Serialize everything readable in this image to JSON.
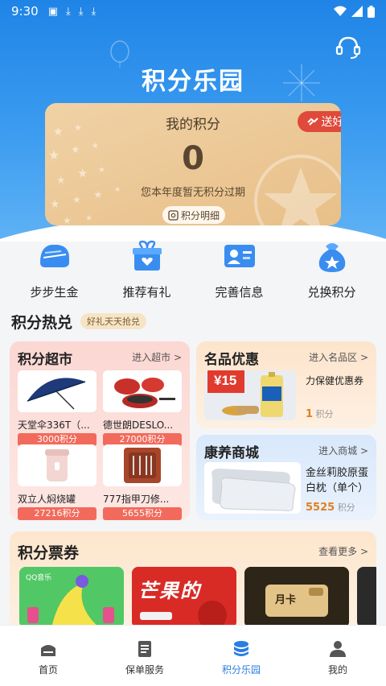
{
  "status": {
    "time": "9:30"
  },
  "header": {
    "title": "积分乐园"
  },
  "points_card": {
    "title": "我的积分",
    "value": "0",
    "note": "您本年度暂无积分过期",
    "detail_label": "积分明细",
    "invite_label": "送好友"
  },
  "quick_actions": [
    {
      "label": "步步生金",
      "icon": "sneaker-icon"
    },
    {
      "label": "推荐有礼",
      "icon": "gift-icon"
    },
    {
      "label": "完善信息",
      "icon": "id-card-icon"
    },
    {
      "label": "兑换积分",
      "icon": "money-bag-icon"
    }
  ],
  "hot_section": {
    "title": "积分热兑",
    "tag": "好礼天天抢兑"
  },
  "supermarket": {
    "title": "积分超市",
    "link": "进入超市 >",
    "items": [
      {
        "name": "天堂伞336T（...",
        "points": "3000积分"
      },
      {
        "name": "德世朗DESLO...",
        "points": "27000积分"
      },
      {
        "name": "双立人焖烧罐",
        "points": "27216积分"
      },
      {
        "name": "777指甲刀修...",
        "points": "5655积分"
      }
    ]
  },
  "brand": {
    "title": "名品优惠",
    "link": "进入名品区 >",
    "item_name": "力保健优惠券",
    "points_value": "1",
    "points_unit": "积分",
    "badge": "¥15"
  },
  "health": {
    "title": "康养商城",
    "link": "进入商城 >",
    "item_name": "金丝莉胶原蛋白枕（单个）",
    "points_value": "5525",
    "points_unit": "积分"
  },
  "tickets": {
    "title": "积分票券",
    "link": "查看更多 >",
    "card_text": [
      "QQ音乐",
      "芒果的",
      "月卡"
    ]
  },
  "tabbar": [
    {
      "label": "首页",
      "icon": "home-icon",
      "active": false
    },
    {
      "label": "保单服务",
      "icon": "document-icon",
      "active": false
    },
    {
      "label": "积分乐园",
      "icon": "coin-stack-icon",
      "active": true
    },
    {
      "label": "我的",
      "icon": "user-icon",
      "active": false
    }
  ],
  "colors": {
    "primary": "#2a7de1",
    "accent": "#e04a3a",
    "gold": "#e8bf88"
  }
}
